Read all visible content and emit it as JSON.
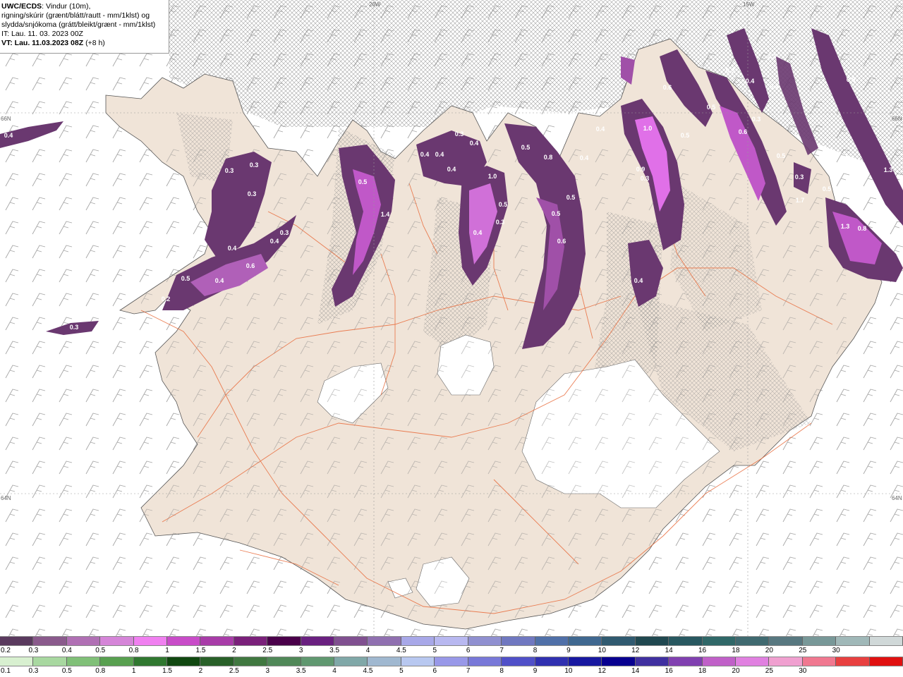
{
  "header": {
    "model": "UWC/ECDS",
    "line1_rest": ": Vindur (10m),",
    "line2": "rigning/skúrir (grænt/blátt/rautt - mm/1klst) og",
    "line3": "slydda/snjókoma (grátt/bleikt/grænt - mm/1klst)",
    "line4": "IT: Lau. 11. 03. 2023 00Z",
    "line5_bold": "VT: Lau. 11.03.2023 08Z",
    "line5_rest": " (+8 h)"
  },
  "grid_labels": {
    "top_left": "20W",
    "top_right": "15W",
    "left_top": "66N",
    "right_top": "66N",
    "left_bottom": "64N",
    "right_bottom": "64N"
  },
  "precip_labels": [
    "0.4",
    "0.3",
    "0.3",
    "0.3",
    "0.5",
    "1.4",
    "0.4",
    "0.4",
    "0.4",
    "0.6",
    "0.5",
    "0.4",
    "0.2",
    "0.3",
    "0.3",
    "0.4",
    "0.4",
    "0.3",
    "0.4",
    "1.0",
    "0.5",
    "0.8",
    "0.3",
    "0.5",
    "0.4",
    "0.5",
    "0.6",
    "0.5",
    "0.4",
    "0.4",
    "1.0",
    "0.9",
    "0.3",
    "0.4",
    "0.5",
    "0.6",
    "0.5",
    "0.6",
    "0.3",
    "0.4",
    "0.5",
    "0.9",
    "0.3",
    "0.5",
    "1.7",
    "0.6",
    "1.3",
    "0.4",
    "0.8",
    "0.4",
    "0.3",
    "1.3"
  ],
  "legend_snow": {
    "colors": [
      "#5a3a5e",
      "#8a5a8c",
      "#b070b4",
      "#d585d8",
      "#f080f0",
      "#c84cc8",
      "#a83ca8",
      "#7a207a",
      "#4a004a",
      "#6a2080",
      "#805090",
      "#9070b0",
      "#a8a8e8",
      "#b8b8f0",
      "#9090d0",
      "#7078c0",
      "#5070a8",
      "#406890",
      "#305a70",
      "#204850",
      "#285860",
      "#306868",
      "#406a70",
      "#587880",
      "#789898",
      "#a0b8b8",
      "#d0d8d8"
    ],
    "ticks": [
      "0.2",
      "0.3",
      "0.4",
      "0.5",
      "0.8",
      "1",
      "1.5",
      "2",
      "2.5",
      "3",
      "3.5",
      "4",
      "4.5",
      "5",
      "6",
      "7",
      "8",
      "9",
      "10",
      "12",
      "14",
      "16",
      "18",
      "20",
      "25",
      "30"
    ]
  },
  "legend_rain": {
    "colors": [
      "#d8f0d0",
      "#a8d8a0",
      "#80c078",
      "#58a050",
      "#307830",
      "#104810",
      "#286028",
      "#407840",
      "#508858",
      "#609870",
      "#80a8a8",
      "#a0b8d0",
      "#b8c8f0",
      "#9898e8",
      "#7878d8",
      "#5050c8",
      "#3030b0",
      "#1818a0",
      "#080090",
      "#4030a0",
      "#8040b0",
      "#c060c8",
      "#e080e0",
      "#f0a0d0",
      "#f07890",
      "#e84040",
      "#e01010"
    ],
    "ticks": [
      "0.1",
      "0.3",
      "0.5",
      "0.8",
      "1",
      "1.5",
      "2",
      "2.5",
      "3",
      "3.5",
      "4",
      "4.5",
      "5",
      "6",
      "7",
      "8",
      "9",
      "10",
      "12",
      "14",
      "16",
      "18",
      "20",
      "25",
      "30"
    ]
  },
  "colors": {
    "land": "#f0e4d8",
    "sea": "#ffffff",
    "roads": "#e86a3a",
    "snow_dark": "#6a3870",
    "snow_mid": "#a050a8",
    "snow_light": "#e070e8"
  }
}
